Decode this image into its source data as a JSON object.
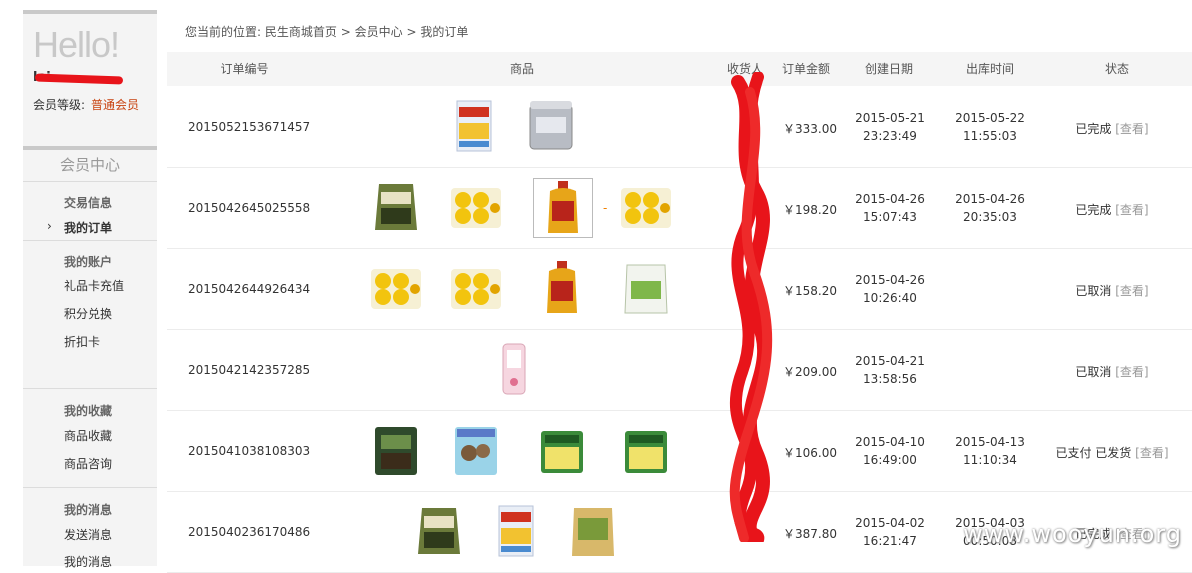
{
  "profile": {
    "greeting": "Hello!",
    "username": "lei...",
    "level_label": "会员等级:",
    "level_value": "普通会员"
  },
  "sidebar": {
    "title": "会员中心",
    "groups": [
      {
        "title": "交易信息",
        "items": [
          "我的订单"
        ]
      },
      {
        "title": "我的账户",
        "items": [
          "礼品卡充值",
          "积分兑换",
          "折扣卡"
        ]
      },
      {
        "title": "我的收藏",
        "items": [
          "商品收藏",
          "商品咨询"
        ]
      },
      {
        "title": "我的消息",
        "items": [
          "发送消息",
          "我的消息"
        ]
      }
    ],
    "active_item": "我的订单",
    "chevron": "›"
  },
  "breadcrumb": {
    "prefix": "您当前的位置:",
    "items": [
      "民生商城首页",
      "会员中心",
      "我的订单"
    ],
    "sep": ">"
  },
  "table": {
    "headers": [
      "订单编号",
      "商品",
      "收货人",
      "订单金额",
      "创建日期",
      "出库时间",
      "状态"
    ],
    "rows": [
      {
        "id": "2015052153671457",
        "amount": "￥333.00",
        "created_date": "2015-05-21",
        "created_time": "23:23:49",
        "out_date": "2015-05-22",
        "out_time": "11:55:03",
        "status": "已完成",
        "view": "[查看]",
        "products": [
          "milk-powder-box-icon",
          "milk-powder-can-icon"
        ]
      },
      {
        "id": "2015042645025558",
        "amount": "￥198.20",
        "created_date": "2015-04-26",
        "created_time": "15:07:43",
        "out_date": "2015-04-26",
        "out_time": "20:35:03",
        "status": "已完成",
        "view": "[查看]",
        "products": [
          "rice-bag-icon",
          "pudding-cups-icon",
          "oil-bottle-icon",
          "pudding-cups-icon"
        ]
      },
      {
        "id": "2015042644926434",
        "amount": "￥158.20",
        "created_date": "2015-04-26",
        "created_time": "10:26:40",
        "out_date": "",
        "out_time": "",
        "status": "已取消",
        "view": "[查看]",
        "products": [
          "pudding-cups-icon",
          "pudding-cups-icon",
          "oil-bottle-icon",
          "flour-bag-icon"
        ]
      },
      {
        "id": "2015042142357285",
        "amount": "￥209.00",
        "created_date": "2015-04-21",
        "created_time": "13:58:56",
        "out_date": "",
        "out_time": "",
        "status": "已取消",
        "view": "[查看]",
        "products": [
          "pink-device-icon"
        ]
      },
      {
        "id": "2015041038108303",
        "amount": "￥106.00",
        "created_date": "2015-04-10",
        "created_time": "16:49:00",
        "out_date": "2015-04-13",
        "out_time": "11:10:34",
        "status": "已支付 已发货",
        "view": "[查看]",
        "products": [
          "tea-bag-icon",
          "mushroom-bag-icon",
          "veggie-pack-icon",
          "veggie-pack-icon"
        ]
      },
      {
        "id": "2015040236170486",
        "amount": "￥387.80",
        "created_date": "2015-04-02",
        "created_time": "16:21:47",
        "out_date": "2015-04-03",
        "out_time": "00:50:08",
        "status": "已完成",
        "view": "[查看]",
        "products": [
          "rice-bag-icon",
          "milk-powder-box-icon",
          "grain-bag-icon"
        ]
      }
    ]
  },
  "watermark": "www.wooyun.org",
  "colors": {
    "accent": "#c8420f",
    "redaction": "#e8141a",
    "header_bg": "#f5f5f5",
    "sidebar_bg": "#f4f4f4"
  }
}
